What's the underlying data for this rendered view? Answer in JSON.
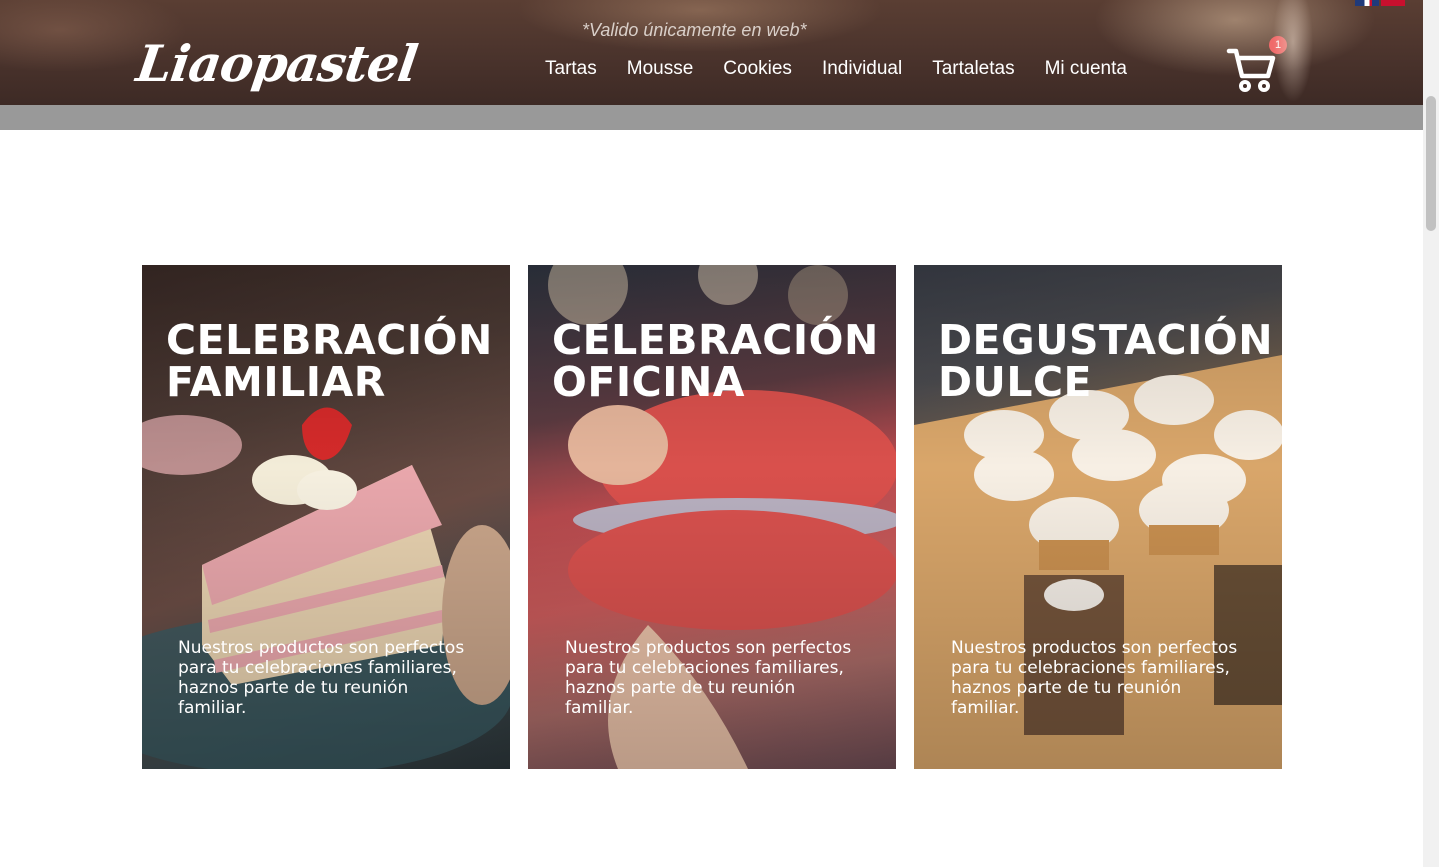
{
  "header": {
    "logo_text": "Liaopastel",
    "promo": "*Valido únicamente en web*",
    "nav": [
      {
        "label": "Tartas"
      },
      {
        "label": "Mousse"
      },
      {
        "label": "Cookies"
      },
      {
        "label": "Individual"
      },
      {
        "label": "Tartaletas"
      },
      {
        "label": "Mi cuenta"
      }
    ],
    "cart_count": "1",
    "languages": [
      "uk-flag-icon",
      "es-flag-icon"
    ]
  },
  "cards": [
    {
      "title_line1": "CELEBRACIÓN",
      "title_line2": "FAMILIAR",
      "description": "Nuestros productos son perfectos para tu celebraciones familiares, haznos parte de tu reunión familiar."
    },
    {
      "title_line1": "CELEBRACIÓN",
      "title_line2": "OFICINA",
      "description": "Nuestros productos son perfectos para tu celebraciones familiares, haznos parte de tu reunión familiar."
    },
    {
      "title_line1": "DEGUSTACIÓN",
      "title_line2": "DULCE",
      "description": "Nuestros productos son perfectos para tu celebraciones familiares, haznos parte de tu reunión familiar."
    }
  ],
  "colors": {
    "header_bg": "#4a332c",
    "header_strip": "#999999",
    "badge": "#f06a6a",
    "text_light": "#ffffff"
  }
}
